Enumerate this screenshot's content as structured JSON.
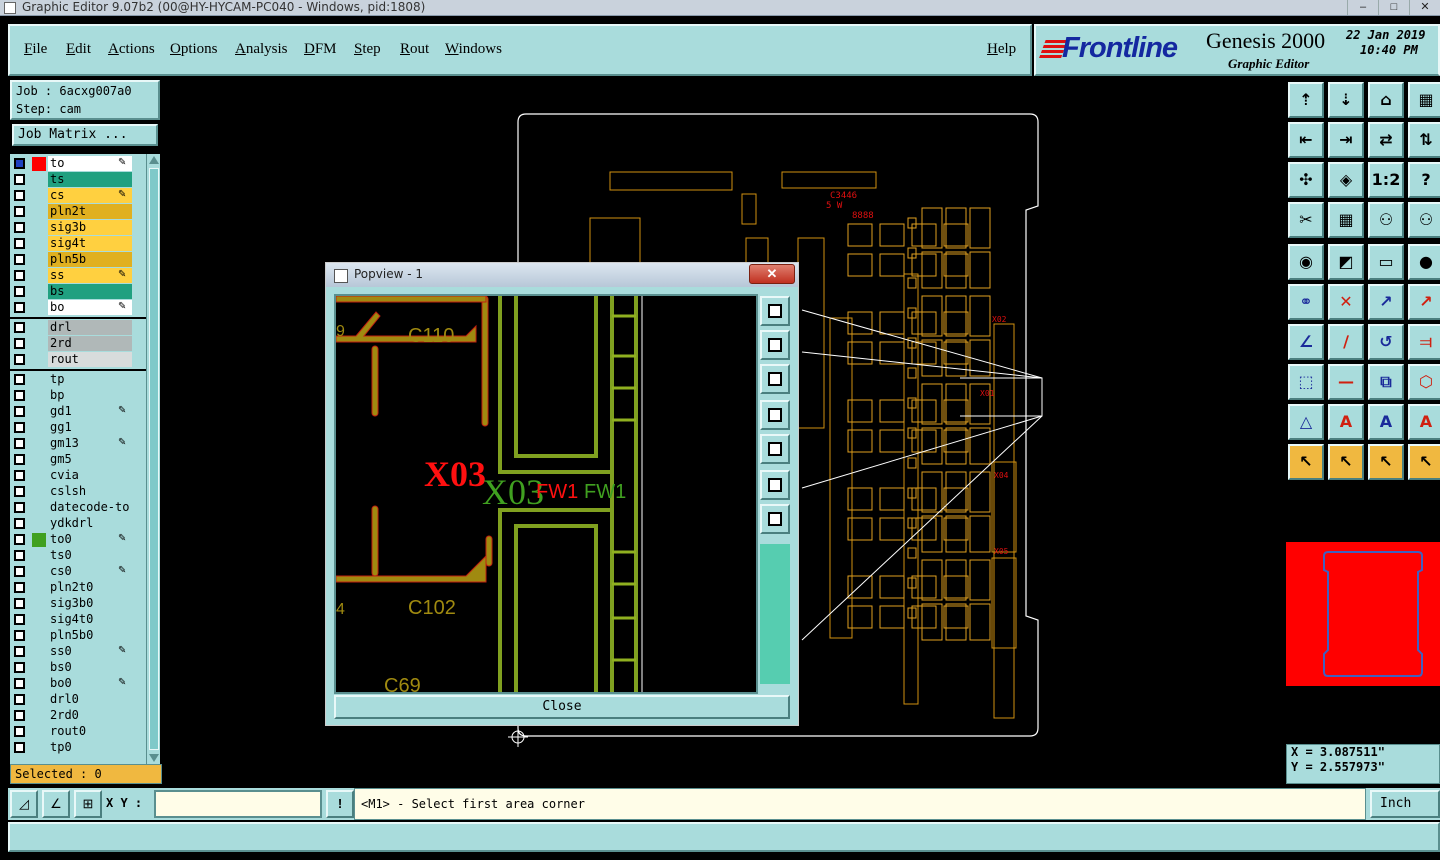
{
  "window": {
    "title": "Graphic Editor 9.07b2 (00@HY-HYCAM-PC040 - Windows, pid:1808)",
    "min": "–",
    "max": "□",
    "close": "✕"
  },
  "menu": {
    "items": [
      "File",
      "Edit",
      "Actions",
      "Options",
      "Analysis",
      "DFM",
      "Step",
      "Rout",
      "Windows"
    ],
    "help": "Help"
  },
  "logo": {
    "brand": "Frontline",
    "product": "Genesis 2000",
    "subtitle": "Graphic Editor",
    "date": "22 Jan 2019",
    "time": "10:40 PM"
  },
  "job": {
    "job_line": "Job : 6acxg007a0",
    "step_line": "Step: cam",
    "matrix_button": "Job Matrix ..."
  },
  "layers": {
    "group1": [
      {
        "name": "to",
        "color": "#ffffff",
        "swatch": "#ff0000",
        "checked_blue": true,
        "pen": true
      },
      {
        "name": "ts",
        "color": "#20a080",
        "swatch": "",
        "pen": false
      },
      {
        "name": "cs",
        "color": "#ffd040",
        "swatch": "",
        "pen": true
      },
      {
        "name": "pln2t",
        "color": "#e0b020",
        "swatch": "",
        "pen": false
      },
      {
        "name": "sig3b",
        "color": "#ffd040",
        "swatch": "",
        "pen": false
      },
      {
        "name": "sig4t",
        "color": "#ffd040",
        "swatch": "",
        "pen": false
      },
      {
        "name": "pln5b",
        "color": "#e0b020",
        "swatch": "",
        "pen": false
      },
      {
        "name": "ss",
        "color": "#ffd040",
        "swatch": "",
        "pen": true
      },
      {
        "name": "bs",
        "color": "#20a080",
        "swatch": "",
        "pen": false
      },
      {
        "name": "bo",
        "color": "#ffffff",
        "swatch": "",
        "pen": true
      }
    ],
    "group2": [
      {
        "name": "drl",
        "color": "#b0b8b8",
        "swatch": "",
        "pen": false
      },
      {
        "name": "2rd",
        "color": "#b0b8b8",
        "swatch": "",
        "pen": false
      },
      {
        "name": "rout",
        "color": "#d8dcdc",
        "swatch": "",
        "pen": false
      }
    ],
    "group3": [
      {
        "name": "tp",
        "color": "#a9dcdc",
        "pen": false
      },
      {
        "name": "bp",
        "color": "#a9dcdc",
        "pen": false
      },
      {
        "name": "gd1",
        "color": "#a9dcdc",
        "pen": true
      },
      {
        "name": "gg1",
        "color": "#a9dcdc",
        "pen": false
      },
      {
        "name": "gm13",
        "color": "#a9dcdc",
        "pen": true
      },
      {
        "name": "gm5",
        "color": "#a9dcdc",
        "pen": false
      },
      {
        "name": "cvia",
        "color": "#a9dcdc",
        "pen": false
      },
      {
        "name": "cslsh",
        "color": "#a9dcdc",
        "pen": false
      },
      {
        "name": "datecode-to",
        "color": "#a9dcdc",
        "pen": false
      },
      {
        "name": "ydkdrl",
        "color": "#a9dcdc",
        "pen": false
      },
      {
        "name": "to0",
        "color": "#a9dcdc",
        "swatch": "#40a020",
        "pen": true
      },
      {
        "name": "ts0",
        "color": "#a9dcdc",
        "pen": false
      },
      {
        "name": "cs0",
        "color": "#a9dcdc",
        "pen": true
      },
      {
        "name": "pln2t0",
        "color": "#a9dcdc",
        "pen": false
      },
      {
        "name": "sig3b0",
        "color": "#a9dcdc",
        "pen": false
      },
      {
        "name": "sig4t0",
        "color": "#a9dcdc",
        "pen": false
      },
      {
        "name": "pln5b0",
        "color": "#a9dcdc",
        "pen": false
      },
      {
        "name": "ss0",
        "color": "#a9dcdc",
        "pen": true
      },
      {
        "name": "bs0",
        "color": "#a9dcdc",
        "pen": false
      },
      {
        "name": "bo0",
        "color": "#a9dcdc",
        "pen": true
      },
      {
        "name": "drl0",
        "color": "#a9dcdc",
        "pen": false
      },
      {
        "name": "2rd0",
        "color": "#a9dcdc",
        "pen": false
      },
      {
        "name": "rout0",
        "color": "#a9dcdc",
        "pen": false
      },
      {
        "name": "tp0",
        "color": "#a9dcdc",
        "pen": false
      }
    ]
  },
  "selected": "Selected : 0",
  "popview": {
    "title": "Popview - 1",
    "close_x": "✕",
    "close_button": "Close",
    "labels": {
      "c110": "C110",
      "x03_red": "X03",
      "x03_green": "X03",
      "fw1a": "FW1",
      "fw1b": "FW1",
      "c102": "C102",
      "c69": "C69",
      "left9": "9",
      "left4": "4"
    }
  },
  "right_tools": {
    "rows": [
      [
        "⇡",
        "⇣",
        "⌂",
        "▦"
      ],
      [
        "⇤",
        "⇥",
        "⇄",
        "⇅"
      ],
      [
        "✣",
        "◈",
        "1:2",
        "?"
      ],
      [
        "✂",
        "▦",
        "⚇",
        "⚇"
      ],
      [
        "◉",
        "◩",
        "▭",
        "●"
      ],
      [
        "⚭",
        "✕",
        "↗",
        "↗"
      ],
      [
        "∠",
        "∕",
        "↺",
        "⫤"
      ],
      [
        "⬚",
        "—",
        "⧉",
        "⬡"
      ],
      [
        "△",
        "A",
        "A",
        "A"
      ],
      [
        "↖",
        "↖",
        "↖",
        "↖"
      ]
    ]
  },
  "coords": {
    "x": "X = 3.087511\"",
    "y": "Y = 2.557973\""
  },
  "bottom": {
    "xy_label": "X Y :",
    "xy_value": "",
    "message": "<M1> - Select first area corner",
    "unit": "Inch",
    "excl": "!"
  },
  "colors": {
    "panel": "#a9dcdc",
    "accent": "#f0b840",
    "red": "#ff0000",
    "board_outline": "#ffffff"
  }
}
